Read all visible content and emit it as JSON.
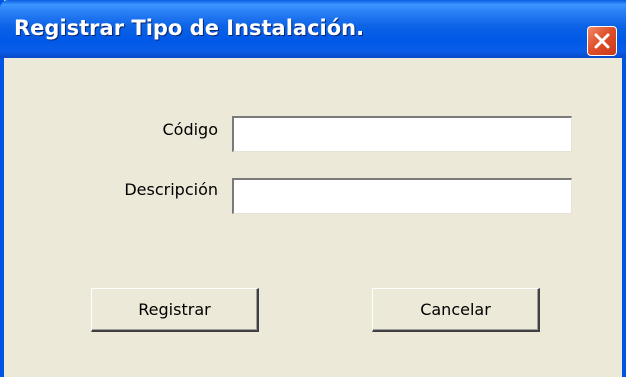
{
  "window": {
    "title": "Registrar Tipo de Instalación."
  },
  "form": {
    "codigo_label": "Código",
    "codigo_value": "",
    "descripcion_label": "Descripción",
    "descripcion_value": ""
  },
  "buttons": {
    "register_label": "Registrar",
    "cancel_label": "Cancelar"
  },
  "icons": {
    "close": "close-icon"
  },
  "colors": {
    "titlebar": "#0058e6",
    "window_body": "#ece9d8",
    "close_button": "#e0502c"
  }
}
